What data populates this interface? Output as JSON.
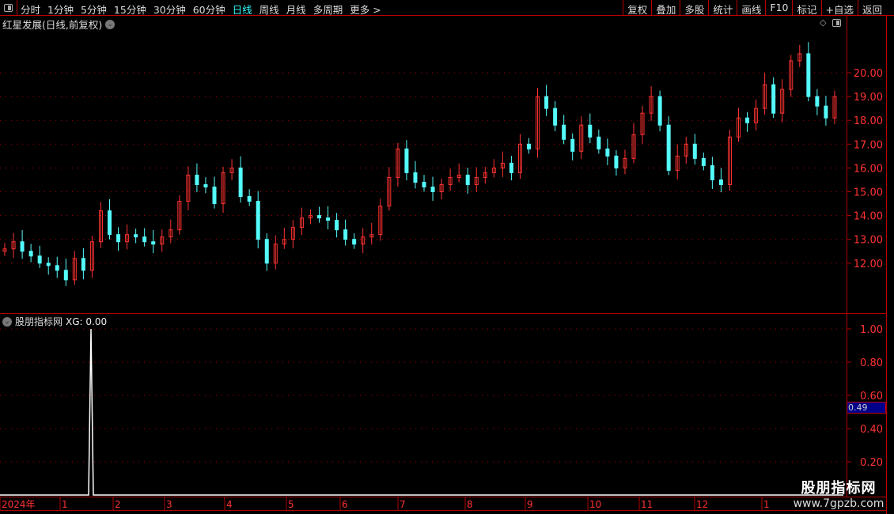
{
  "toolbar": {
    "periods": [
      "分时",
      "1分钟",
      "5分钟",
      "15分钟",
      "30分钟",
      "60分钟",
      "日线",
      "周线",
      "月线",
      "多周期",
      "更多 >"
    ],
    "active": "日线",
    "right_buttons": [
      "复权",
      "叠加",
      "多股",
      "统计",
      "画线",
      "F10",
      "标记",
      "+自选",
      "返回"
    ]
  },
  "main_panel": {
    "title": "红星发展(日线,前复权)",
    "y_ticks": [
      "20.00",
      "19.00",
      "18.00",
      "17.00",
      "16.00",
      "15.00",
      "14.00",
      "13.00",
      "12.00"
    ]
  },
  "indicator_panel": {
    "title": "股朋指标网",
    "series_label": "XG: 0.00",
    "y_ticks": [
      "1.00",
      "0.80",
      "0.60",
      "0.40",
      "0.20"
    ],
    "cursor_value": "0.49"
  },
  "time_axis": {
    "labels": [
      "2024年",
      "1",
      "2",
      "3",
      "4",
      "5",
      "6",
      "7",
      "8",
      "9",
      "10",
      "11",
      "12",
      "1"
    ]
  },
  "watermark": {
    "name": "股朋指标网",
    "url": "www.7gpzb.com"
  },
  "colors": {
    "up": "#ff3232",
    "down": "#54fcfc",
    "axis": "#b00000",
    "signal": "#ffffff",
    "cursor_bg": "#00008b"
  },
  "chart_data": {
    "type": "candlestick",
    "ylim": [
      11,
      21
    ],
    "closes": [
      12.6,
      12.9,
      12.5,
      12.3,
      12.0,
      11.9,
      11.7,
      11.3,
      12.2,
      11.7,
      12.9,
      14.2,
      13.2,
      12.9,
      13.2,
      13.1,
      12.9,
      12.8,
      13.1,
      13.4,
      14.6,
      15.7,
      15.3,
      15.2,
      14.5,
      15.8,
      16.0,
      14.8,
      14.6,
      13.0,
      12.0,
      12.8,
      13.0,
      13.5,
      13.9,
      14.0,
      13.9,
      13.8,
      13.4,
      13.0,
      12.8,
      13.1,
      13.2,
      14.4,
      15.6,
      16.8,
      15.8,
      15.4,
      15.2,
      15.0,
      15.3,
      15.6,
      15.7,
      15.3,
      15.6,
      15.8,
      16.0,
      16.2,
      15.8,
      17.0,
      16.8,
      19.0,
      18.5,
      17.8,
      17.2,
      16.7,
      17.8,
      17.3,
      16.8,
      16.5,
      16.0,
      16.4,
      17.4,
      18.3,
      19.0,
      17.8,
      15.9,
      16.5,
      17.0,
      16.4,
      16.1,
      15.5,
      15.3,
      17.3,
      18.1,
      17.9,
      18.5,
      19.5,
      18.3,
      19.3,
      20.5,
      20.8,
      19.0,
      18.6,
      18.1,
      19.0
    ],
    "xg_signal": {
      "index": 10,
      "value": 1.0,
      "ylim": [
        0,
        1.1
      ]
    }
  }
}
